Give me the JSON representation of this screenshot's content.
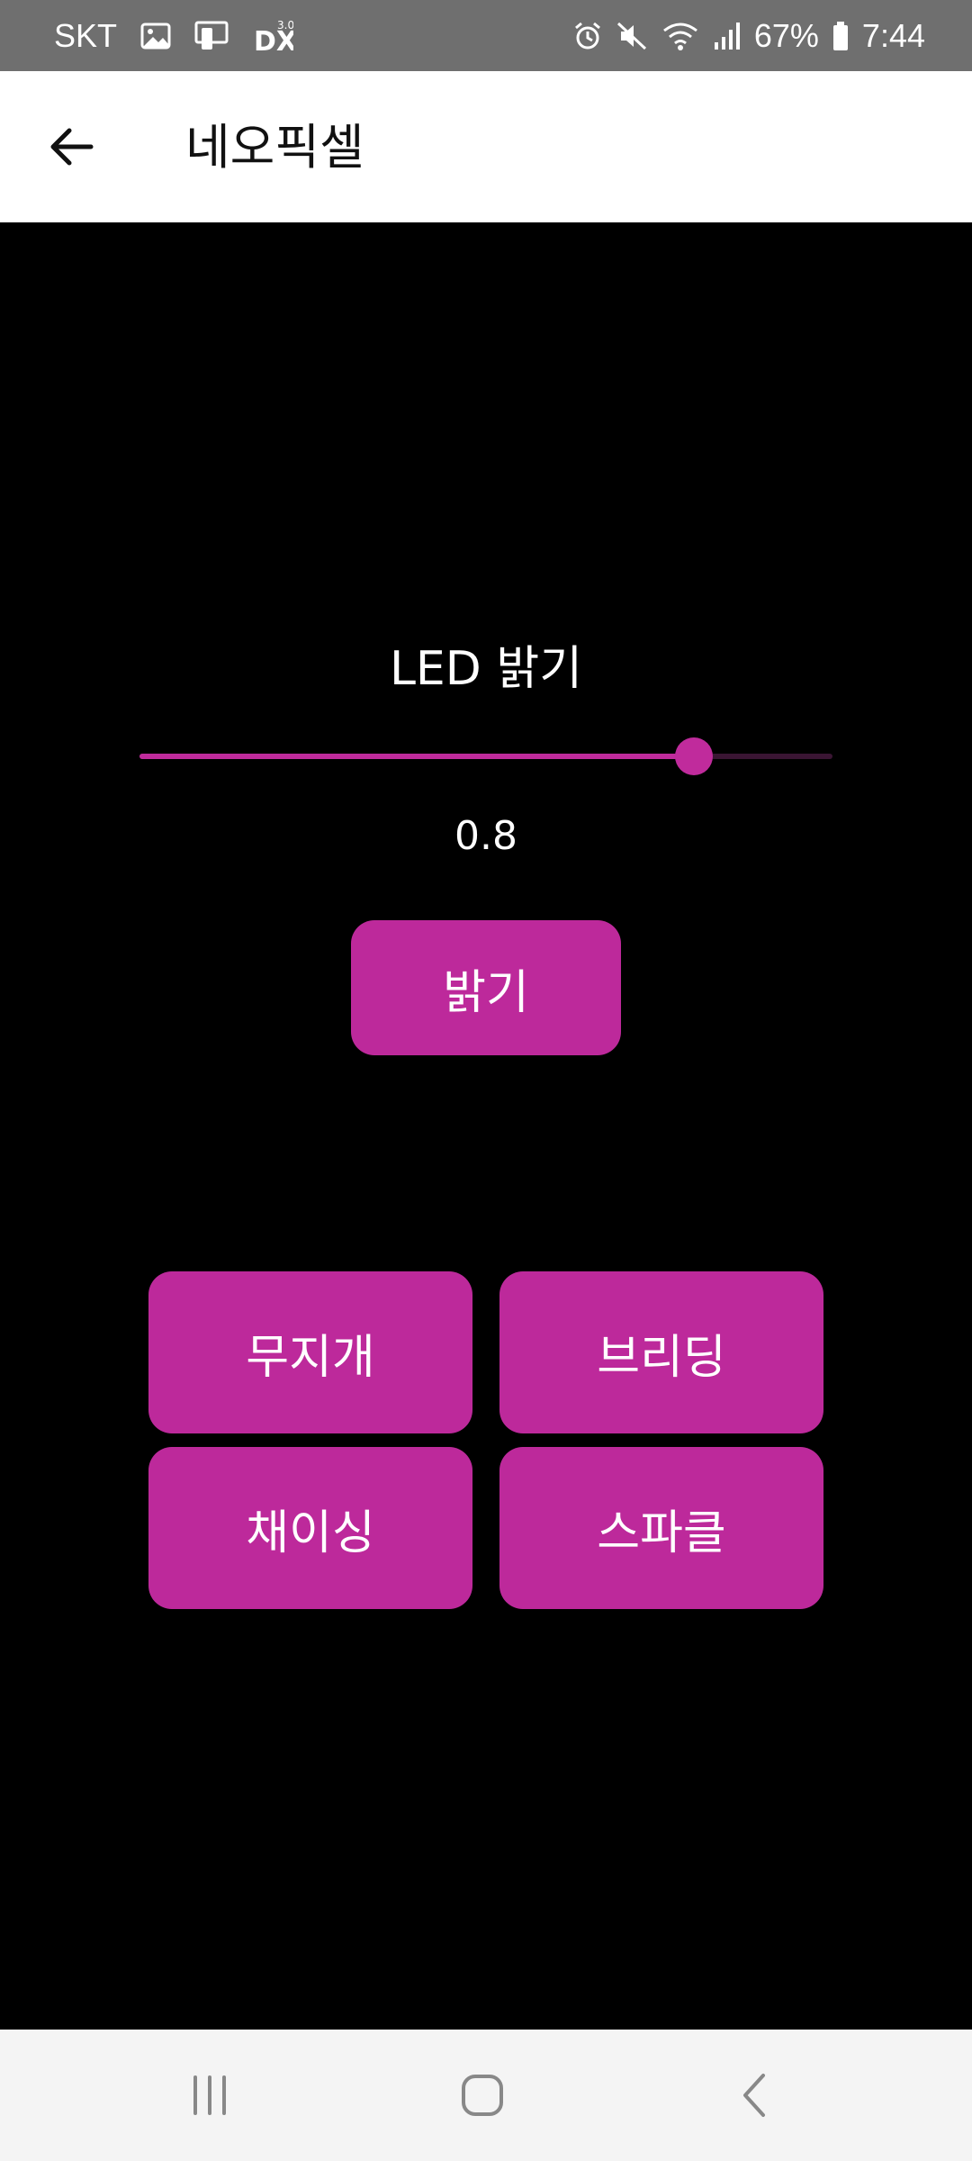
{
  "status_bar": {
    "carrier": "SKT",
    "battery": "67%",
    "time": "7:44",
    "left_icons": [
      "gallery-icon",
      "screen-mirror-icon",
      "dex-3.0-icon"
    ],
    "right_icons": [
      "alarm-icon",
      "mute-icon",
      "wifi-icon",
      "signal-icon",
      "battery-icon"
    ]
  },
  "app_bar": {
    "title": "네오픽셀",
    "back_icon": "arrow-left-icon"
  },
  "brightness": {
    "label": "LED 밝기",
    "value_text": "0.8",
    "value": 0.8,
    "min": 0,
    "max": 1,
    "button_label": "밝기"
  },
  "effects": {
    "rainbow_label": "무지개",
    "breathing_label": "브리딩",
    "chasing_label": "채이싱",
    "sparkle_label": "스파클"
  },
  "colors": {
    "accent": "#bd299b",
    "background": "#000000",
    "app_bar": "#ffffff",
    "status_bar": "#6f6f6f",
    "nav_bar": "#f4f4f4"
  },
  "nav_bar": {
    "icons": [
      "recent-apps-icon",
      "home-icon",
      "back-icon"
    ]
  }
}
